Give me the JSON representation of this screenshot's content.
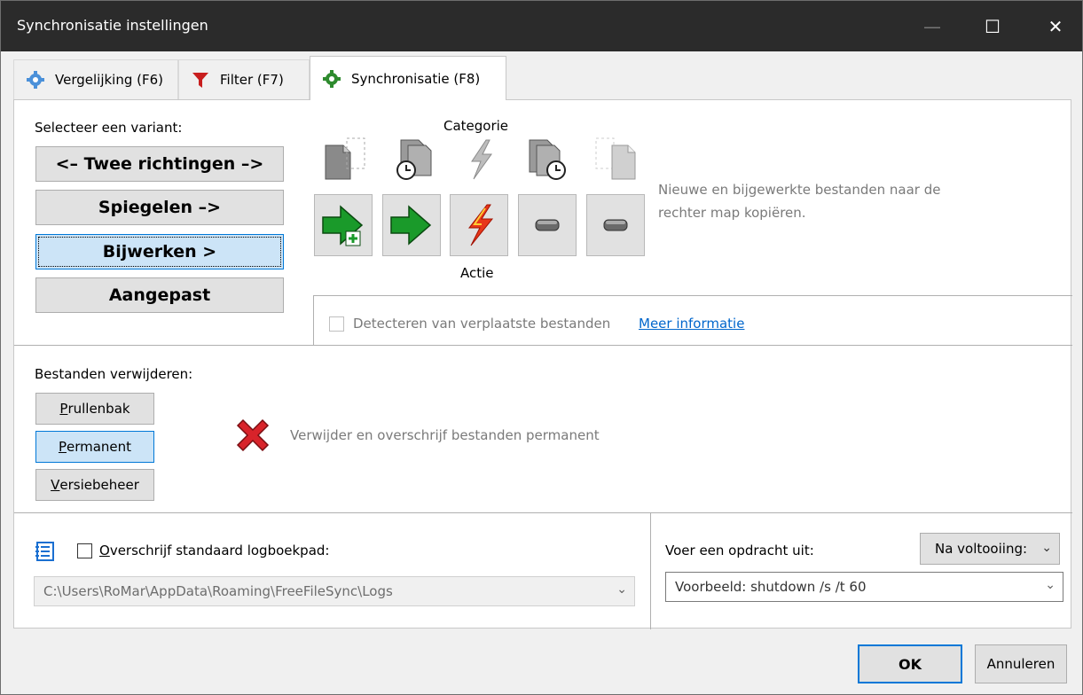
{
  "window": {
    "title": "Synchronisatie instellingen",
    "minimize_glyph": "—",
    "maximize_glyph": "☐",
    "close_glyph": "✕"
  },
  "tabs": [
    {
      "label": "Vergelijking (F6)",
      "icon": "gear-icon"
    },
    {
      "label": "Filter (F7)",
      "icon": "funnel-icon"
    },
    {
      "label": "Synchronisatie (F8)",
      "icon": "gear-green-icon",
      "active": true
    }
  ],
  "variant": {
    "heading": "Selecteer een variant:",
    "options": [
      "<– Twee richtingen –>",
      "Spiegelen –>",
      "Bijwerken >",
      "Aangepast"
    ],
    "selected": "Bijwerken >"
  },
  "categories": {
    "category_label": "Categorie",
    "action_label": "Actie",
    "description": [
      "Nieuwe en bijgewerkte bestanden naar de",
      "rechter map kopiëren."
    ]
  },
  "detect_moved": {
    "label": "Detecteren van verplaatste bestanden",
    "link": "Meer informatie",
    "checked": false,
    "enabled": false
  },
  "delete_files": {
    "heading": "Bestanden verwijderen:",
    "options": [
      {
        "first": "P",
        "rest": "rullenbak"
      },
      {
        "first": "P",
        "rest": "ermanent"
      },
      {
        "first": "V",
        "rest": "ersiebeheer"
      }
    ],
    "selected": "Permanent",
    "description": "Verwijder en overschrijf bestanden permanent"
  },
  "log": {
    "checkbox_first": "O",
    "checkbox_rest": "verschrijf standaard logboekpad:",
    "checked": false,
    "path": "C:\\Users\\RoMar\\AppData\\Roaming\\FreeFileSync\\Logs"
  },
  "command": {
    "label": "Voer een opdracht uit:",
    "when": "Na voltooiing:",
    "placeholder": "Voorbeeld: shutdown /s /t 60"
  },
  "footer": {
    "ok": "OK",
    "cancel": "Annuleren"
  },
  "colors": {
    "accent": "#0078d7",
    "title_bg": "#2b2b2b",
    "link": "#0066cc"
  }
}
